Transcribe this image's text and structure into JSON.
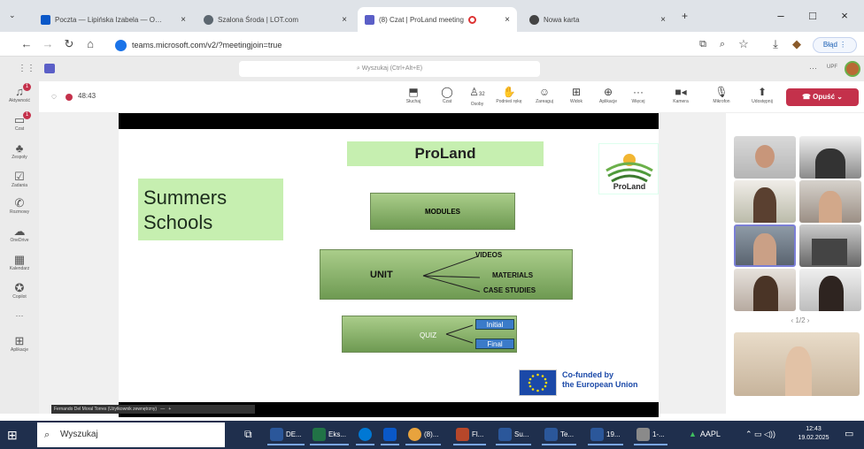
{
  "browser": {
    "tabs": [
      {
        "label": "Poczta — Lipińska Izabela — O…",
        "icon_color": "#0a58c8"
      },
      {
        "label": "Szalona Środa | LOT.com",
        "icon_color": "#5c6770"
      },
      {
        "label": "(8) Czat | ProLand meeting",
        "icon_color": "#5b5fc7"
      },
      {
        "label": "Nowa karta",
        "icon_color": "#444"
      }
    ],
    "url": "teams.microsoft.com/v2/?meetingjoin=true",
    "error_button": "Błąd"
  },
  "teams": {
    "search_placeholder": "Wyszukaj (Ctrl+Alt+E)",
    "user_initials": "UPF",
    "rail": [
      {
        "label": "Aktywność",
        "icon": "bell-icon",
        "badge": "1"
      },
      {
        "label": "Czat",
        "icon": "chat-icon",
        "badge": "1"
      },
      {
        "label": "Zespoły",
        "icon": "teams-icon"
      },
      {
        "label": "Zadania",
        "icon": "tasks-icon"
      },
      {
        "label": "Rozmowy",
        "icon": "phone-icon"
      },
      {
        "label": "OneDrive",
        "icon": "cloud-icon"
      },
      {
        "label": "Kalendarz",
        "icon": "calendar-icon"
      },
      {
        "label": "Copilot",
        "icon": "copilot-icon"
      },
      {
        "label": "Aplikacje",
        "icon": "apps-icon"
      }
    ]
  },
  "meeting": {
    "timer": "48:43",
    "tools": [
      {
        "label": "Słuchaj",
        "icon": "share-icon"
      },
      {
        "label": "Czat",
        "icon": "chat-icon"
      },
      {
        "label": "Osoby",
        "icon": "people-icon",
        "count": "32"
      },
      {
        "label": "Podnieś rękę",
        "icon": "hand-icon"
      },
      {
        "label": "Zareaguj",
        "icon": "react-icon"
      },
      {
        "label": "Widok",
        "icon": "view-icon"
      },
      {
        "label": "Aplikacje",
        "icon": "apps-icon"
      },
      {
        "label": "Więcej",
        "icon": "more-icon"
      }
    ],
    "camera_label": "Kamera",
    "mic_label": "Mikrofon",
    "share_label": "Udostępnij",
    "leave_label": "Opuść",
    "presenter_name": "Fernando Del Moral Torres (Użytkownik zewnętrzny)",
    "pager": "1/2"
  },
  "slide": {
    "title": "ProLand",
    "logo_text": "ProLand",
    "summer_line1": "Summers",
    "summer_line2": "Schools",
    "modules": "MODULES",
    "unit": "UNIT",
    "unit_items": [
      "VIDEOS",
      "MATERIALS",
      "CASE STUDIES"
    ],
    "quiz": "QUIZ",
    "quiz_items": [
      "Initial",
      "Final"
    ],
    "eu_line1": "Co-funded by",
    "eu_line2": "the European Union",
    "colors": {
      "green_box": "#6e9a52",
      "light_green": "#c6efb0",
      "blue_tag": "#3b7bc9",
      "eu_blue": "#1b49a8"
    }
  },
  "taskbar": {
    "search": "Wyszukaj",
    "apps": [
      {
        "label": "DE...",
        "color": "#2b579a"
      },
      {
        "label": "Eks...",
        "color": "#217346"
      },
      {
        "label": "",
        "color": "#0078d4"
      },
      {
        "label": "",
        "color": "#0a58c8"
      },
      {
        "label": "(8)...",
        "color": "#e8a33d"
      },
      {
        "label": "Fl...",
        "color": "#b7472a"
      },
      {
        "label": "Su...",
        "color": "#2b579a"
      },
      {
        "label": "Te...",
        "color": "#2b579a"
      },
      {
        "label": "19...",
        "color": "#2b579a"
      },
      {
        "label": "1-...",
        "color": "#8a8a8a"
      }
    ],
    "stock": "AAPL",
    "time": "12:43",
    "date": "19.02.2025"
  }
}
